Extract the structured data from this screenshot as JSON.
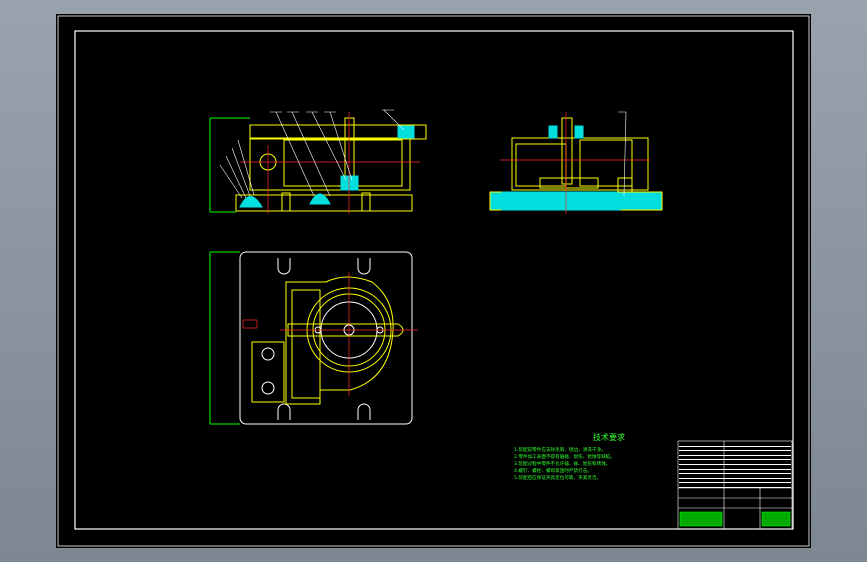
{
  "drawing": {
    "colors": {
      "background": "#000000",
      "frame": "#ffffff",
      "part_outline": "#ffff00",
      "centerline": "#ff2a2a",
      "hatch": "#00dede",
      "dimension": "#00ff00",
      "callout": "#ffffff"
    },
    "technical_requirements": {
      "title": "技术要求",
      "lines": [
        "1.装配前零件应去除毛刺、锐边，清洗干净。",
        "2.零件加工表面不得有磕碰、划伤、锈蚀等缺陷。",
        "3.装配过程中零件不允许磕、碰、划伤和锈蚀。",
        "4.螺钉、螺栓、螺母紧固时严禁打击。",
        "5.装配后应保证夹具定位可靠，夹紧灵活。"
      ]
    },
    "views": [
      "front-view",
      "side-view",
      "top-view"
    ]
  }
}
